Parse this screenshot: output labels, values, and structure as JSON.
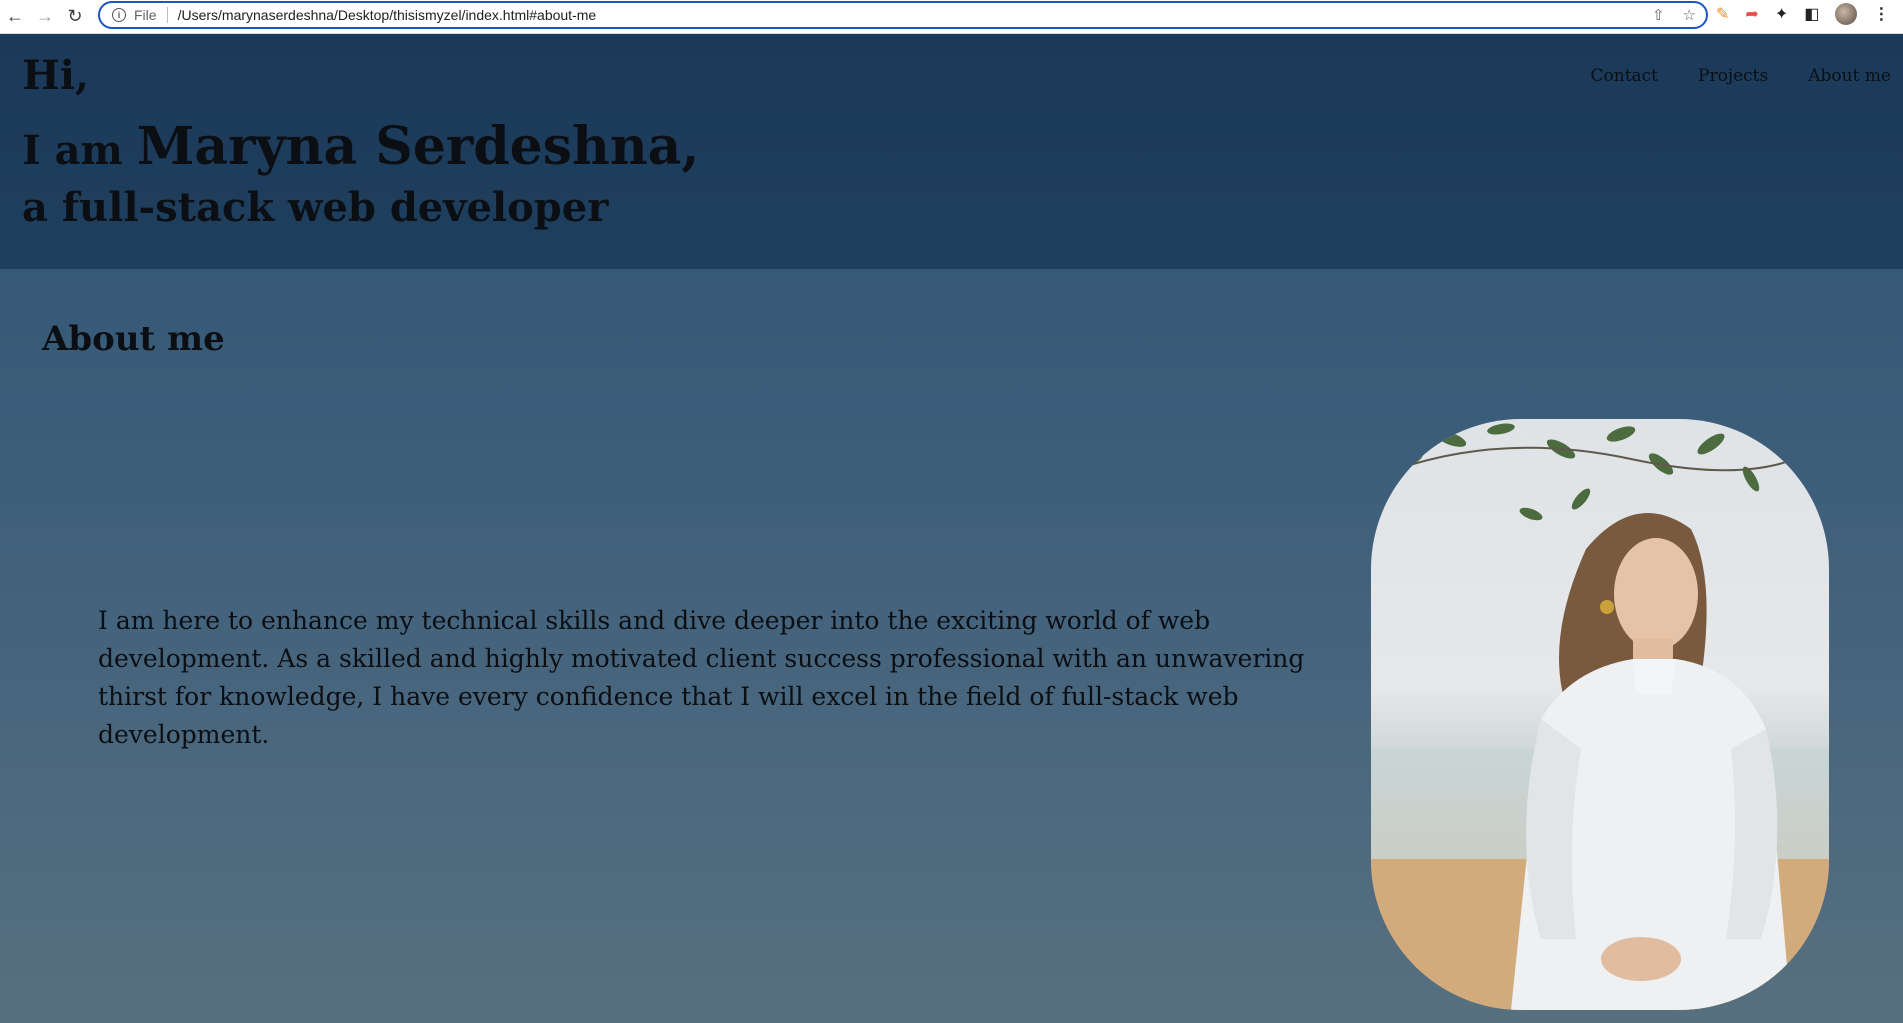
{
  "browser": {
    "file_label": "File",
    "url": "/Users/marynaserdeshna/Desktop/thisismyzel/index.html#about-me",
    "nav_icons": [
      "arrow-left-icon",
      "arrow-right-icon",
      "reload-icon"
    ],
    "omnibox_icons": [
      "share-icon",
      "star-icon"
    ],
    "extension_icons": [
      "pencil-icon",
      "extension-icon",
      "puzzle-icon",
      "side-panel-icon",
      "profile-avatar",
      "menu-kebab-icon"
    ]
  },
  "header": {
    "greeting": "Hi,",
    "intro_prefix": "I am ",
    "name": "Maryna Serdeshna,",
    "role": "a full-stack web developer",
    "nav": [
      {
        "label": "Contact"
      },
      {
        "label": "Projects"
      },
      {
        "label": "About me"
      }
    ]
  },
  "about": {
    "title": "About me",
    "text": "I am here to enhance my technical skills and dive deeper into the exciting world of web development. As a skilled and highly motivated client success professional with an unwavering thirst for knowledge, I have every confidence that I will excel in the field of full-stack web development."
  },
  "colors": {
    "header_bg": "#1c3b5a",
    "page_bg_top": "#2c5373",
    "page_bg_bottom": "#577080",
    "text": "#0b0f14",
    "omnibox_border": "#1a56c4"
  }
}
